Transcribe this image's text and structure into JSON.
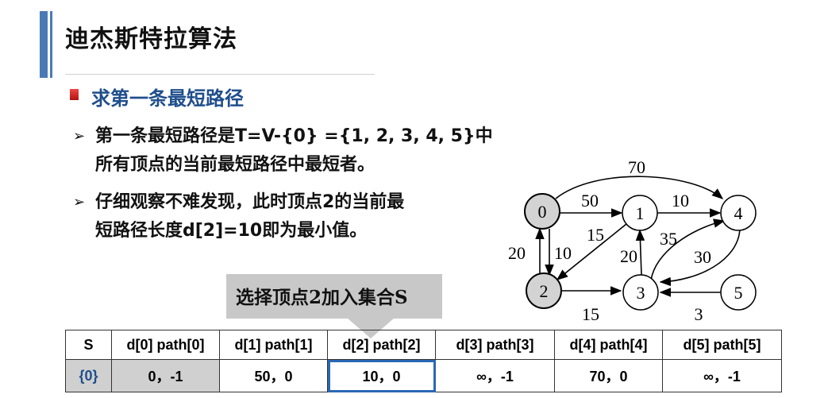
{
  "header": {
    "title": "迪杰斯特拉算法",
    "subtitle": "求第一条最短路径"
  },
  "bullets": [
    {
      "arrow": "➢",
      "line1": "第一条最短路径是T=V-{0} ={1, 2, 3, 4, 5}中",
      "line2": "所有顶点的当前最短路径中最短者。"
    },
    {
      "arrow": "➢",
      "line1": "仔细观察不难发现，此时顶点2的当前最",
      "line2": "短路径长度d[2]=10即为最小值。"
    }
  ],
  "callout": "选择顶点2加入集合S",
  "graph": {
    "nodes": [
      {
        "label": "0",
        "highlighted": true
      },
      {
        "label": "1",
        "highlighted": false
      },
      {
        "label": "2",
        "highlighted": true
      },
      {
        "label": "3",
        "highlighted": false
      },
      {
        "label": "4",
        "highlighted": false
      },
      {
        "label": "5",
        "highlighted": false
      }
    ],
    "edges": [
      {
        "from": "0",
        "to": "4",
        "weight": "70"
      },
      {
        "from": "0",
        "to": "1",
        "weight": "50"
      },
      {
        "from": "1",
        "to": "4",
        "weight": "10"
      },
      {
        "from": "1",
        "to": "2",
        "weight": "15"
      },
      {
        "from": "2",
        "to": "0",
        "weight": "20"
      },
      {
        "from": "0",
        "to": "2",
        "weight": "10"
      },
      {
        "from": "3",
        "to": "1",
        "weight": "20"
      },
      {
        "from": "3",
        "to": "4",
        "weight": "35"
      },
      {
        "from": "4",
        "to": "3",
        "weight": "30"
      },
      {
        "from": "2",
        "to": "3",
        "weight": "15"
      },
      {
        "from": "5",
        "to": "3",
        "weight": "3"
      }
    ],
    "node_fill": "#d3d3d3"
  },
  "table": {
    "headers": [
      "S",
      "d[0] path[0]",
      "d[1] path[1]",
      "d[2] path[2]",
      "d[3] path[3]",
      "d[4] path[4]",
      "d[5] path[5]"
    ],
    "row": {
      "s": "{0}",
      "cells": [
        "0，-1",
        "50，0",
        "10，0",
        "∞，-1",
        "70，0",
        "∞，-1"
      ]
    },
    "accent_color": "#1f4e8c",
    "highlight_color": "#2a68b4"
  }
}
